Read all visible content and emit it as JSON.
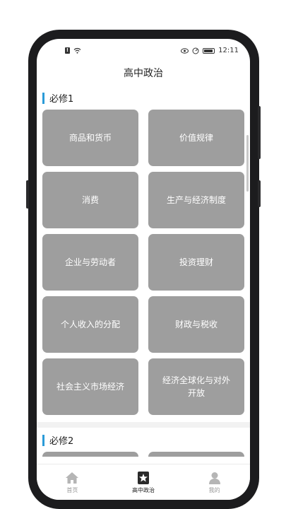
{
  "status": {
    "time": "12:11"
  },
  "title": "高中政治",
  "sections": [
    {
      "title": "必修1",
      "items": [
        "商品和货币",
        "价值规律",
        "消费",
        "生产与经济制度",
        "企业与劳动者",
        "投资理财",
        "个人收入的分配",
        "财政与税收",
        "社会主义市场经济",
        "经济全球化与对外开放"
      ]
    },
    {
      "title": "必修2",
      "items": [
        "",
        ""
      ]
    }
  ],
  "tabs": [
    {
      "label": "首页",
      "icon": "home-icon"
    },
    {
      "label": "高中政治",
      "icon": "star-icon"
    },
    {
      "label": "我的",
      "icon": "user-icon"
    }
  ],
  "colors": {
    "accent": "#2b9bd8",
    "card": "#9e9e9e"
  }
}
